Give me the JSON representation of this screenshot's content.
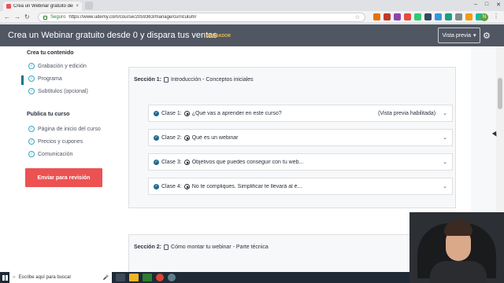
{
  "browser": {
    "tab_title": "Crea un Webinar gratuito desde",
    "tab_close": "×",
    "secure_label": "Seguro",
    "url": "https://www.udemy.com/course/2059363/manage/curriculum/",
    "profile_initial": "N"
  },
  "header": {
    "course_title": "Crea un Webinar gratuito desde 0 y dispara tus ventas",
    "draft_badge": "BORRADOR",
    "preview_label": "Vista previa"
  },
  "sidebar": {
    "create_heading": "Crea tu contenido",
    "create_items": [
      "Grabación y edición",
      "Programa",
      "Subtítulos (opcional)"
    ],
    "publish_heading": "Publica tu curso",
    "publish_items": [
      "Página de inicio del curso",
      "Precios y cupones",
      "Comunicación"
    ],
    "submit_label": "Enviar para revisión"
  },
  "sections": [
    {
      "label": "Sección 1:",
      "title": "Introducción - Conceptos iniciales",
      "lectures": [
        {
          "label": "Clase 1:",
          "title": "¿Qué vas a aprender en este curso?",
          "preview": "(Vista previa habilitada)"
        },
        {
          "label": "Clase 2:",
          "title": "Qué es un webinar",
          "preview": ""
        },
        {
          "label": "Clase 3:",
          "title": "Objetivos que puedes conseguir con tu web...",
          "preview": ""
        },
        {
          "label": "Clase 4:",
          "title": "No te compliques. Simplificar te llevará al é...",
          "preview": ""
        }
      ]
    },
    {
      "label": "Sección 2:",
      "title": "Cómo montar tu webinar - Parte técnica",
      "lectures": []
    }
  ],
  "taskbar": {
    "search_placeholder": "Escribe aquí para buscar"
  },
  "colors": {
    "header_bg": "#505763",
    "submit_red": "#ec5252",
    "accent_teal": "#007791",
    "draft_yellow": "#f4c150"
  }
}
